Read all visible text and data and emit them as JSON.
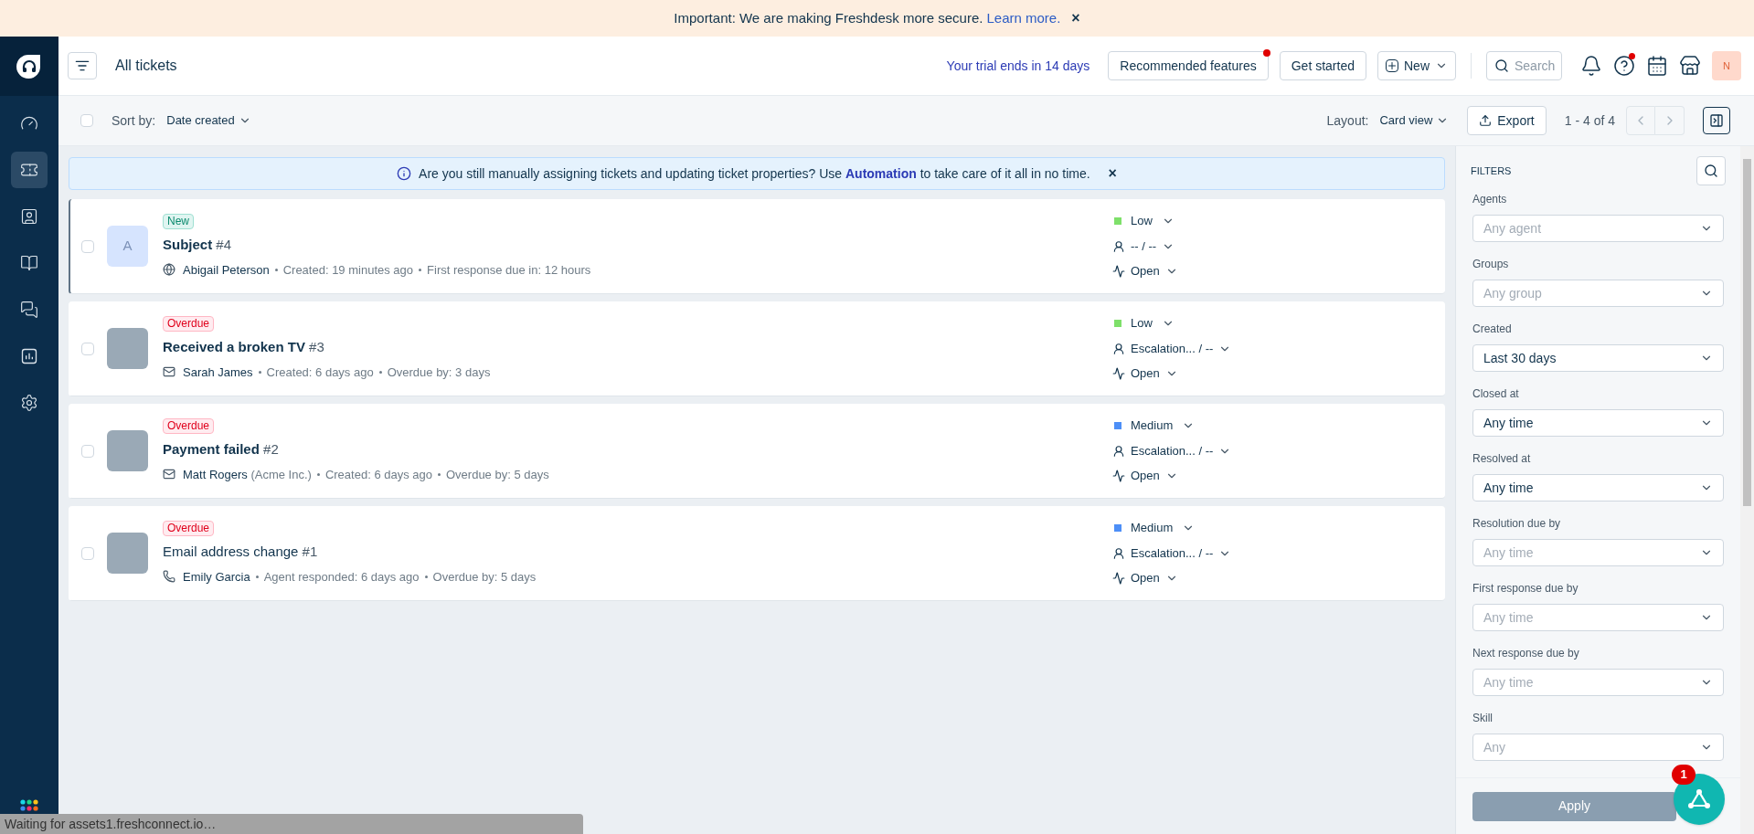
{
  "announcement": {
    "text": "Important: We are making Freshdesk more secure.",
    "link": "Learn more.",
    "close": "×"
  },
  "sidebar": {
    "items": [
      {
        "kind": "dashboard",
        "selected": false
      },
      {
        "kind": "tickets",
        "selected": true
      },
      {
        "kind": "contacts",
        "selected": false
      },
      {
        "kind": "knowledge",
        "selected": false
      },
      {
        "kind": "conversations",
        "selected": false
      },
      {
        "kind": "reports",
        "selected": false
      },
      {
        "kind": "settings",
        "selected": false
      }
    ]
  },
  "header": {
    "title": "All tickets",
    "trial": "Your trial ends in 14 days",
    "recommended": "Recommended features",
    "recommended_dot": true,
    "get_started": "Get started",
    "new": "New",
    "search_placeholder": "Search",
    "help_dot": true,
    "avatar": "N"
  },
  "toolbar": {
    "sort_label": "Sort by:",
    "sort_value": "Date created",
    "select_all_checked": false,
    "layout_label": "Layout:",
    "layout_value": "Card view",
    "export": "Export",
    "pagination": "1 - 4 of 4"
  },
  "tip": {
    "before": "Are you still manually assigning tickets and updating ticket properties? Use",
    "link": "Automation",
    "after": "to take care of it all in no time.",
    "close": "×"
  },
  "tickets": [
    {
      "selected": true,
      "checked": false,
      "badge": {
        "kind": "new",
        "text": "New"
      },
      "avatar": {
        "kind": "initial",
        "letter": "A"
      },
      "subject": "Subject",
      "number": "#4",
      "unread": true,
      "source": {
        "kind": "web"
      },
      "requester": "Abigail Peterson",
      "meta": [
        "Created: 19 minutes ago",
        "First response due in: 12 hours"
      ],
      "priority": {
        "label": "Low",
        "color": "#7ee06a"
      },
      "assignment": "-- / --",
      "status": "Open"
    },
    {
      "selected": false,
      "checked": false,
      "badge": {
        "kind": "overdue",
        "text": "Overdue"
      },
      "avatar": {
        "kind": "photo"
      },
      "subject": "Received a broken TV",
      "number": "#3",
      "unread": true,
      "source": {
        "kind": "email"
      },
      "requester": "Sarah James",
      "meta": [
        "Created: 6 days ago",
        "Overdue by: 3 days"
      ],
      "priority": {
        "label": "Low",
        "color": "#7ee06a"
      },
      "assignment": "Escalation... / --",
      "status": "Open"
    },
    {
      "selected": false,
      "checked": false,
      "badge": {
        "kind": "overdue",
        "text": "Overdue"
      },
      "avatar": {
        "kind": "photo"
      },
      "subject": "Payment failed",
      "number": "#2",
      "unread": true,
      "source": {
        "kind": "email"
      },
      "requester": "Matt Rogers",
      "company": "(Acme Inc.)",
      "meta": [
        "Created: 6 days ago",
        "Overdue by: 5 days"
      ],
      "priority": {
        "label": "Medium",
        "color": "#4d8ff7"
      },
      "assignment": "Escalation... / --",
      "status": "Open"
    },
    {
      "selected": false,
      "checked": false,
      "badge": {
        "kind": "overdue",
        "text": "Overdue"
      },
      "avatar": {
        "kind": "photo"
      },
      "subject": "Email address change",
      "number": "#1",
      "unread": false,
      "source": {
        "kind": "phone"
      },
      "requester": "Emily Garcia",
      "meta": [
        "Agent responded: 6 days ago",
        "Overdue by: 5 days"
      ],
      "priority": {
        "label": "Medium",
        "color": "#4d8ff7"
      },
      "assignment": "Escalation... / --",
      "status": "Open"
    }
  ],
  "filters": {
    "title": "FILTERS",
    "fields": [
      {
        "label": "Agents",
        "placeholder": "Any agent"
      },
      {
        "label": "Groups",
        "placeholder": "Any group"
      },
      {
        "label": "Created",
        "value": "Last 30 days"
      },
      {
        "label": "Closed at",
        "value": "Any time"
      },
      {
        "label": "Resolved at",
        "value": "Any time"
      },
      {
        "label": "Resolution due by",
        "placeholder": "Any time"
      },
      {
        "label": "First response due by",
        "placeholder": "Any time"
      },
      {
        "label": "Next response due by",
        "placeholder": "Any time"
      },
      {
        "label": "Skill",
        "placeholder": "Any"
      }
    ],
    "apply": "Apply",
    "apply_disabled": true
  },
  "chat_widget": {
    "badge": "1"
  },
  "status_bar": "Waiting for assets1.freshconnect.io…"
}
